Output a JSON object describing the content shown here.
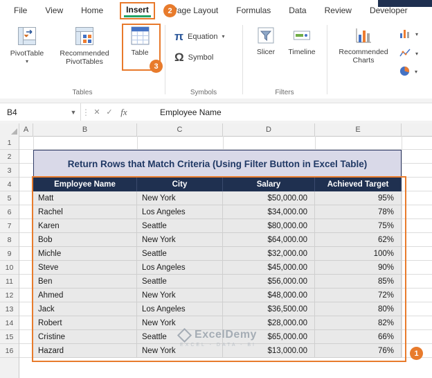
{
  "tabs": {
    "items": [
      {
        "label": "File"
      },
      {
        "label": "View"
      },
      {
        "label": "Home"
      },
      {
        "label": "Insert"
      },
      {
        "label": "Page Layout"
      },
      {
        "label": "Formulas"
      },
      {
        "label": "Data"
      },
      {
        "label": "Review"
      },
      {
        "label": "Developer"
      }
    ]
  },
  "ribbon": {
    "pivottable": "PivotTable",
    "recommended_pivottables": "Recommended PivotTables",
    "table": "Table",
    "equation": "Equation",
    "symbol": "Symbol",
    "slicer": "Slicer",
    "timeline": "Timeline",
    "recommended_charts": "Recommended Charts",
    "groups": {
      "tables": "Tables",
      "symbols": "Symbols",
      "filters": "Filters"
    }
  },
  "formula_bar": {
    "name_box": "B4",
    "fx": "fx",
    "value": "Employee Name"
  },
  "annotations": {
    "m1": "1",
    "m2": "2",
    "m3": "3"
  },
  "sheet": {
    "columns": [
      "A",
      "B",
      "C",
      "D",
      "E"
    ],
    "row_numbers": [
      "1",
      "2",
      "3",
      "4",
      "5",
      "6",
      "7",
      "8",
      "9",
      "10",
      "11",
      "12",
      "13",
      "14",
      "15",
      "16"
    ],
    "title": "Return Rows that Match Criteria (Using Filter Button in Excel Table)",
    "table": {
      "headers": [
        "Employee Name",
        "City",
        "Salary",
        "Achieved Target"
      ],
      "rows": [
        [
          "Matt",
          "New York",
          "$50,000.00",
          "95%"
        ],
        [
          "Rachel",
          "Los Angeles",
          "$34,000.00",
          "78%"
        ],
        [
          "Karen",
          "Seattle",
          "$80,000.00",
          "75%"
        ],
        [
          "Bob",
          "New York",
          "$64,000.00",
          "62%"
        ],
        [
          "Michle",
          "Seattle",
          "$32,000.00",
          "100%"
        ],
        [
          "Steve",
          "Los Angeles",
          "$45,000.00",
          "90%"
        ],
        [
          "Ben",
          "Seattle",
          "$56,000.00",
          "85%"
        ],
        [
          "Ahmed",
          "New York",
          "$48,000.00",
          "72%"
        ],
        [
          "Jack",
          "Los Angeles",
          "$36,500.00",
          "80%"
        ],
        [
          "Robert",
          "New York",
          "$28,000.00",
          "82%"
        ],
        [
          "Cristine",
          "Seattle",
          "$65,000.00",
          "66%"
        ],
        [
          "Hazard",
          "New York",
          "$13,000.00",
          "76%"
        ]
      ]
    },
    "watermark": {
      "brand": "ExcelDemy",
      "tagline": "EXCEL - DATA - BI"
    }
  },
  "colors": {
    "accent_green": "#21a366",
    "annotation_orange": "#E87B2C",
    "header_navy": "#1F3050",
    "title_blue": "#1F3864"
  }
}
